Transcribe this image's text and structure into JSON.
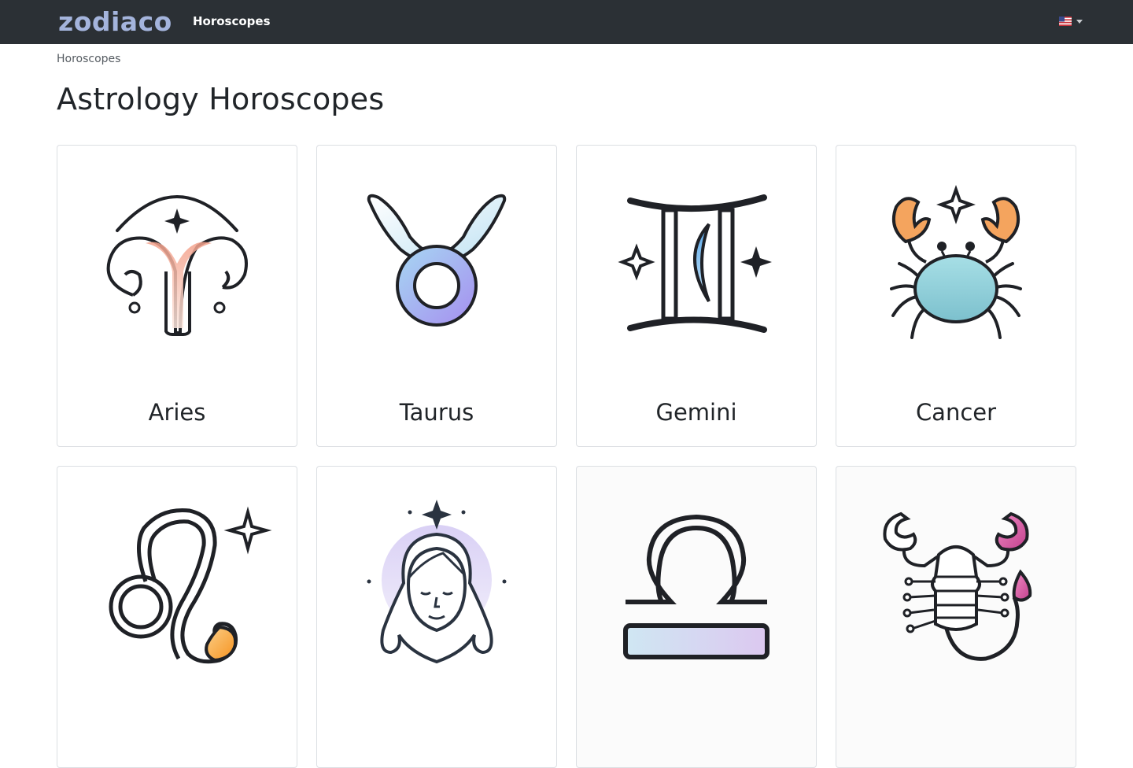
{
  "navbar": {
    "brand": "zodiaco",
    "links": [
      "Horoscopes"
    ],
    "language_icon": "us-flag-icon"
  },
  "breadcrumb": "Horoscopes",
  "page_title": "Astrology Horoscopes",
  "signs": [
    {
      "label": "Aries",
      "icon": "aries-icon"
    },
    {
      "label": "Taurus",
      "icon": "taurus-icon"
    },
    {
      "label": "Gemini",
      "icon": "gemini-icon"
    },
    {
      "label": "Cancer",
      "icon": "cancer-icon"
    },
    {
      "label": "",
      "icon": "leo-icon"
    },
    {
      "label": "",
      "icon": "virgo-icon"
    },
    {
      "label": "",
      "icon": "libra-icon"
    },
    {
      "label": "",
      "icon": "scorpio-icon"
    }
  ],
  "colors": {
    "navbar_bg": "#2b3035",
    "brand": "#a4b4dc",
    "card_border": "#dcdfe3"
  }
}
